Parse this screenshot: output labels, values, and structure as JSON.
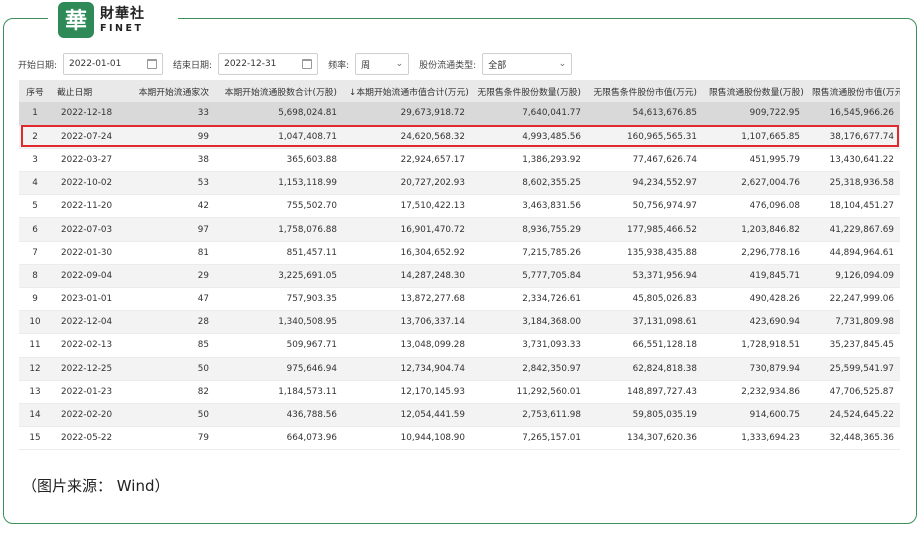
{
  "brand": {
    "name_cn": "財華社",
    "name_en": "FINET",
    "seal_char": "華"
  },
  "filters": {
    "start_label": "开始日期:",
    "start_value": "2022-01-01",
    "end_label": "结束日期:",
    "end_value": "2022-12-31",
    "freq_label": "频率:",
    "freq_value": "周",
    "type_label": "股份流通类型:",
    "type_value": "全部"
  },
  "table": {
    "headers": [
      "序号",
      "截止日期",
      "本期开始流通家次",
      "本期开始流通股数合计(万股)",
      "↓本期开始流通市值合计(万元)",
      "无限售条件股份数量(万股)",
      "无限售条件股份市值(万元)",
      "限售流通股份数量(万股)",
      "限售流通股份市值(万元)"
    ],
    "rows": [
      [
        "1",
        "2022-12-18",
        "33",
        "5,698,024.81",
        "29,673,918.72",
        "7,640,041.77",
        "54,613,676.85",
        "909,722.95",
        "16,545,966.26"
      ],
      [
        "2",
        "2022-07-24",
        "99",
        "1,047,408.71",
        "24,620,568.32",
        "4,993,485.56",
        "160,965,565.31",
        "1,107,665.85",
        "38,176,677.74"
      ],
      [
        "3",
        "2022-03-27",
        "38",
        "365,603.88",
        "22,924,657.17",
        "1,386,293.92",
        "77,467,626.74",
        "451,995.79",
        "13,430,641.22"
      ],
      [
        "4",
        "2022-10-02",
        "53",
        "1,153,118.99",
        "20,727,202.93",
        "8,602,355.25",
        "94,234,552.97",
        "2,627,004.76",
        "25,318,936.58"
      ],
      [
        "5",
        "2022-11-20",
        "42",
        "755,502.70",
        "17,510,422.13",
        "3,463,831.56",
        "50,756,974.97",
        "476,096.08",
        "18,104,451.27"
      ],
      [
        "6",
        "2022-07-03",
        "97",
        "1,758,076.88",
        "16,901,470.72",
        "8,936,755.29",
        "177,985,466.52",
        "1,203,846.82",
        "41,229,867.69"
      ],
      [
        "7",
        "2022-01-30",
        "81",
        "851,457.11",
        "16,304,652.92",
        "7,215,785.26",
        "135,938,435.88",
        "2,296,778.16",
        "44,894,964.61"
      ],
      [
        "8",
        "2022-09-04",
        "29",
        "3,225,691.05",
        "14,287,248.30",
        "5,777,705.84",
        "53,371,956.94",
        "419,845.71",
        "9,126,094.09"
      ],
      [
        "9",
        "2023-01-01",
        "47",
        "757,903.35",
        "13,872,277.68",
        "2,334,726.61",
        "45,805,026.83",
        "490,428.26",
        "22,247,999.06"
      ],
      [
        "10",
        "2022-12-04",
        "28",
        "1,340,508.95",
        "13,706,337.14",
        "3,184,368.00",
        "37,131,098.61",
        "423,690.94",
        "7,731,809.98"
      ],
      [
        "11",
        "2022-02-13",
        "85",
        "509,967.71",
        "13,048,099.28",
        "3,731,093.33",
        "66,551,128.18",
        "1,728,918.51",
        "35,237,845.45"
      ],
      [
        "12",
        "2022-12-25",
        "50",
        "975,646.94",
        "12,734,904.74",
        "2,842,350.97",
        "62,824,818.38",
        "730,879.94",
        "25,599,541.97"
      ],
      [
        "13",
        "2022-01-23",
        "82",
        "1,184,573.11",
        "12,170,145.93",
        "11,292,560.01",
        "148,897,727.43",
        "2,232,934.86",
        "47,706,525.87"
      ],
      [
        "14",
        "2022-02-20",
        "50",
        "436,788.56",
        "12,054,441.59",
        "2,753,611.98",
        "59,805,035.19",
        "914,600.75",
        "24,524,645.22"
      ],
      [
        "15",
        "2022-05-22",
        "79",
        "664,073.96",
        "10,944,108.90",
        "7,265,157.01",
        "134,307,620.36",
        "1,333,694.23",
        "32,448,365.36"
      ]
    ]
  },
  "watermark": {
    "text_cn": "財華社",
    "text_en": "FINET"
  },
  "source_note": "（图片来源： Wind）",
  "colors": {
    "brand_green": "#2e8b57",
    "highlight_red": "#e0282f"
  }
}
